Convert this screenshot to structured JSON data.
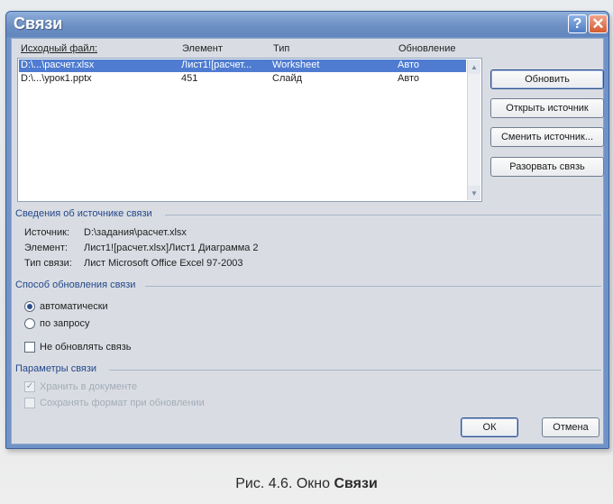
{
  "window": {
    "title": "Связи",
    "help_label": "?",
    "close_label": "✕"
  },
  "list": {
    "headers": {
      "source_file": "Исходный файл:",
      "element": "Элемент",
      "type": "Тип",
      "update": "Обновление"
    },
    "rows": [
      {
        "source": "D:\\...\\расчет.xlsx",
        "element": "Лист1![расчет...",
        "type": "Worksheet",
        "update": "Авто",
        "selected": true
      },
      {
        "source": "D:\\...\\урок1.pptx",
        "element": "451",
        "type": "Слайд",
        "update": "Авто",
        "selected": false
      }
    ]
  },
  "buttons": {
    "update": "Обновить",
    "open_source": "Открыть источник",
    "change_source": "Сменить источник...",
    "break_link": "Разорвать связь",
    "ok": "ОК",
    "cancel": "Отмена"
  },
  "source_info": {
    "title": "Сведения об источнике связи",
    "source_label": "Источник:",
    "source_value": "D:\\задания\\расчет.xlsx",
    "element_label": "Элемент:",
    "element_value": "Лист1![расчет.xlsx]Лист1 Диаграмма 2",
    "link_type_label": "Тип связи:",
    "link_type_value": "Лист Microsoft Office Excel 97-2003"
  },
  "update_method": {
    "title": "Способ обновления связи",
    "automatic": "автоматически",
    "on_request": "по запросу",
    "do_not_update": "Не обновлять связь",
    "selected": "automatic"
  },
  "link_params": {
    "title": "Параметры связи",
    "store_in_document": "Хранить в документе",
    "store_checked": true,
    "keep_format": "Сохранять формат при обновлении",
    "keep_format_checked": false
  },
  "caption": {
    "prefix": "Рис. 4.6. Окно ",
    "bold": "Связи"
  }
}
